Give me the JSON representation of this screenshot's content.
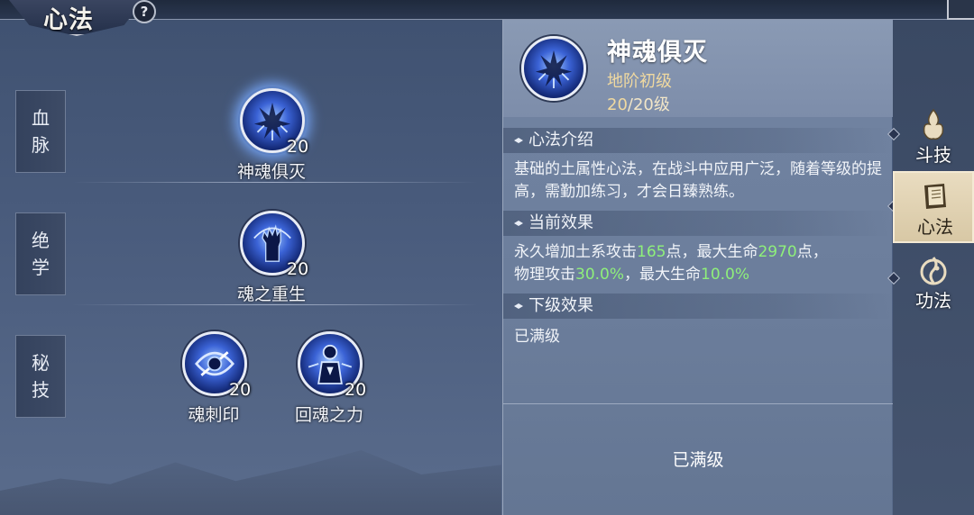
{
  "header": {
    "title": "心法",
    "help_label": "?"
  },
  "categories": [
    {
      "label": "血\n脉",
      "chars": [
        "血",
        "脉"
      ]
    },
    {
      "label": "绝\n学",
      "chars": [
        "绝",
        "学"
      ]
    },
    {
      "label": "秘\n技",
      "chars": [
        "秘",
        "技"
      ]
    }
  ],
  "skills": [
    {
      "name": "神魂俱灭",
      "level": "20",
      "selected": true,
      "icon": "shadow-burst-icon"
    },
    {
      "name": "魂之重生",
      "level": "20",
      "selected": false,
      "icon": "rising-hand-icon"
    },
    {
      "name": "魂刺印",
      "level": "20",
      "selected": false,
      "icon": "soul-thorn-icon"
    },
    {
      "name": "回魂之力",
      "level": "20",
      "selected": false,
      "icon": "soul-return-icon"
    }
  ],
  "detail": {
    "name": "神魂俱灭",
    "grade": "地阶初级",
    "level_current": "20",
    "level_text": "/20级",
    "sections": {
      "intro_title": "心法介绍",
      "intro_text": "基础的土属性心法，在战斗中应用广泛，随着等级的提高，需勤加练习，才会日臻熟练。",
      "current_title": "当前效果",
      "current_line1_a": "永久增加土系攻击",
      "current_line1_v1": "165",
      "current_line1_b": "点，最大生命",
      "current_line1_v2": "2970",
      "current_line1_c": "点，",
      "current_line2_a": "物理攻击",
      "current_line2_v1": "30.0%",
      "current_line2_b": "，最大生命",
      "current_line2_v2": "10.0%",
      "next_title": "下级效果",
      "next_text": "已满级"
    },
    "bottom_status": "已满级"
  },
  "side_tabs": [
    {
      "label": "斗技",
      "icon": "flame-crest-icon",
      "active": false
    },
    {
      "label": "心法",
      "icon": "book-icon",
      "active": true
    },
    {
      "label": "功法",
      "icon": "dragon-flame-icon",
      "active": false
    }
  ],
  "colors": {
    "highlight_value": "#8ff07a",
    "grade_text": "#f0d9a0",
    "active_tab_bg": "#e9dcc0"
  }
}
